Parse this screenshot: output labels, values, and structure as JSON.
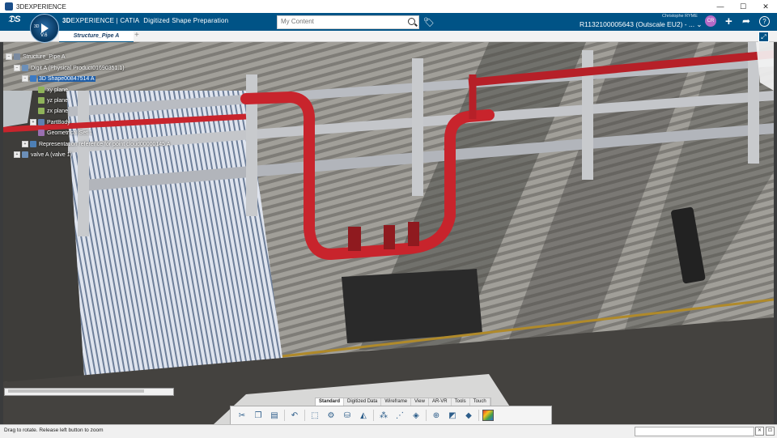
{
  "window": {
    "title": "3DEXPERIENCE",
    "minimize": "—",
    "maximize": "☐",
    "close": "✕"
  },
  "topbar": {
    "compass_version": "V.6",
    "compass_3d": "3D",
    "brand_bold": "3D",
    "brand_rest": "EXPERIENCE | CATIA",
    "app_name": "Digitized Shape Preparation",
    "search_placeholder": "My Content",
    "user_name": "Christophe RYME",
    "tenant": "R1132100005643  (Outscale EU2) - ... ⌄",
    "avatar_initials": "CR"
  },
  "tabs": [
    {
      "label": "Structure_Pipe A",
      "active": true
    }
  ],
  "tab_add": "+",
  "tree": [
    {
      "label": "Structure_Pipe A",
      "selected": false,
      "icon_color": "#7a8aa0"
    },
    {
      "label": "Digit A (Physical Product01690351.1)",
      "selected": false,
      "icon_color": "#6c8fb8"
    },
    {
      "label": "3D Shape00847514 A",
      "selected": true,
      "icon_color": "#3c7ac4"
    },
    {
      "label": "xy plane",
      "selected": false,
      "icon_color": "#8fb35a"
    },
    {
      "label": "yz plane",
      "selected": false,
      "icon_color": "#8fb35a"
    },
    {
      "label": "zx plane",
      "selected": false,
      "icon_color": "#8fb35a"
    },
    {
      "label": "PartBody",
      "selected": false,
      "icon_color": "#5f7fb0"
    },
    {
      "label": "Geometrical Set.1",
      "selected": false,
      "icon_color": "#9a6fb0"
    },
    {
      "label": "Representation reference for point cloud00000145 A",
      "selected": false,
      "icon_color": "#4d7fb5"
    },
    {
      "label": "valve A (valve 1)",
      "selected": false,
      "icon_color": "#6c8fb8"
    }
  ],
  "action_tabs": [
    "Standard",
    "Digitized Data",
    "Wireframe",
    "View",
    "AR-VR",
    "Tools",
    "Touch"
  ],
  "toolbar": [
    {
      "name": "cut-icon",
      "glyph": "✂"
    },
    {
      "name": "copy-icon",
      "glyph": "❐"
    },
    {
      "name": "paste-icon",
      "glyph": "📋"
    },
    {
      "name": "undo-icon",
      "glyph": "↶"
    },
    {
      "name": "select-icon",
      "glyph": "⬚"
    },
    {
      "name": "settings-icon",
      "glyph": "⚙"
    },
    {
      "name": "cloud-import-icon",
      "glyph": "⛁"
    },
    {
      "name": "mesh-icon",
      "glyph": "◭"
    },
    {
      "name": "points-icon",
      "glyph": "⁂"
    },
    {
      "name": "filter-icon",
      "glyph": "⋰"
    },
    {
      "name": "activate-icon",
      "glyph": "◈"
    },
    {
      "name": "align-icon",
      "glyph": "⊕"
    },
    {
      "name": "section-icon",
      "glyph": "◩"
    },
    {
      "name": "shape-icon",
      "glyph": "◆"
    }
  ],
  "status": {
    "text": "Drag to rotate. Release left button to zoom",
    "clear": "✕",
    "clear2": "⊡"
  }
}
